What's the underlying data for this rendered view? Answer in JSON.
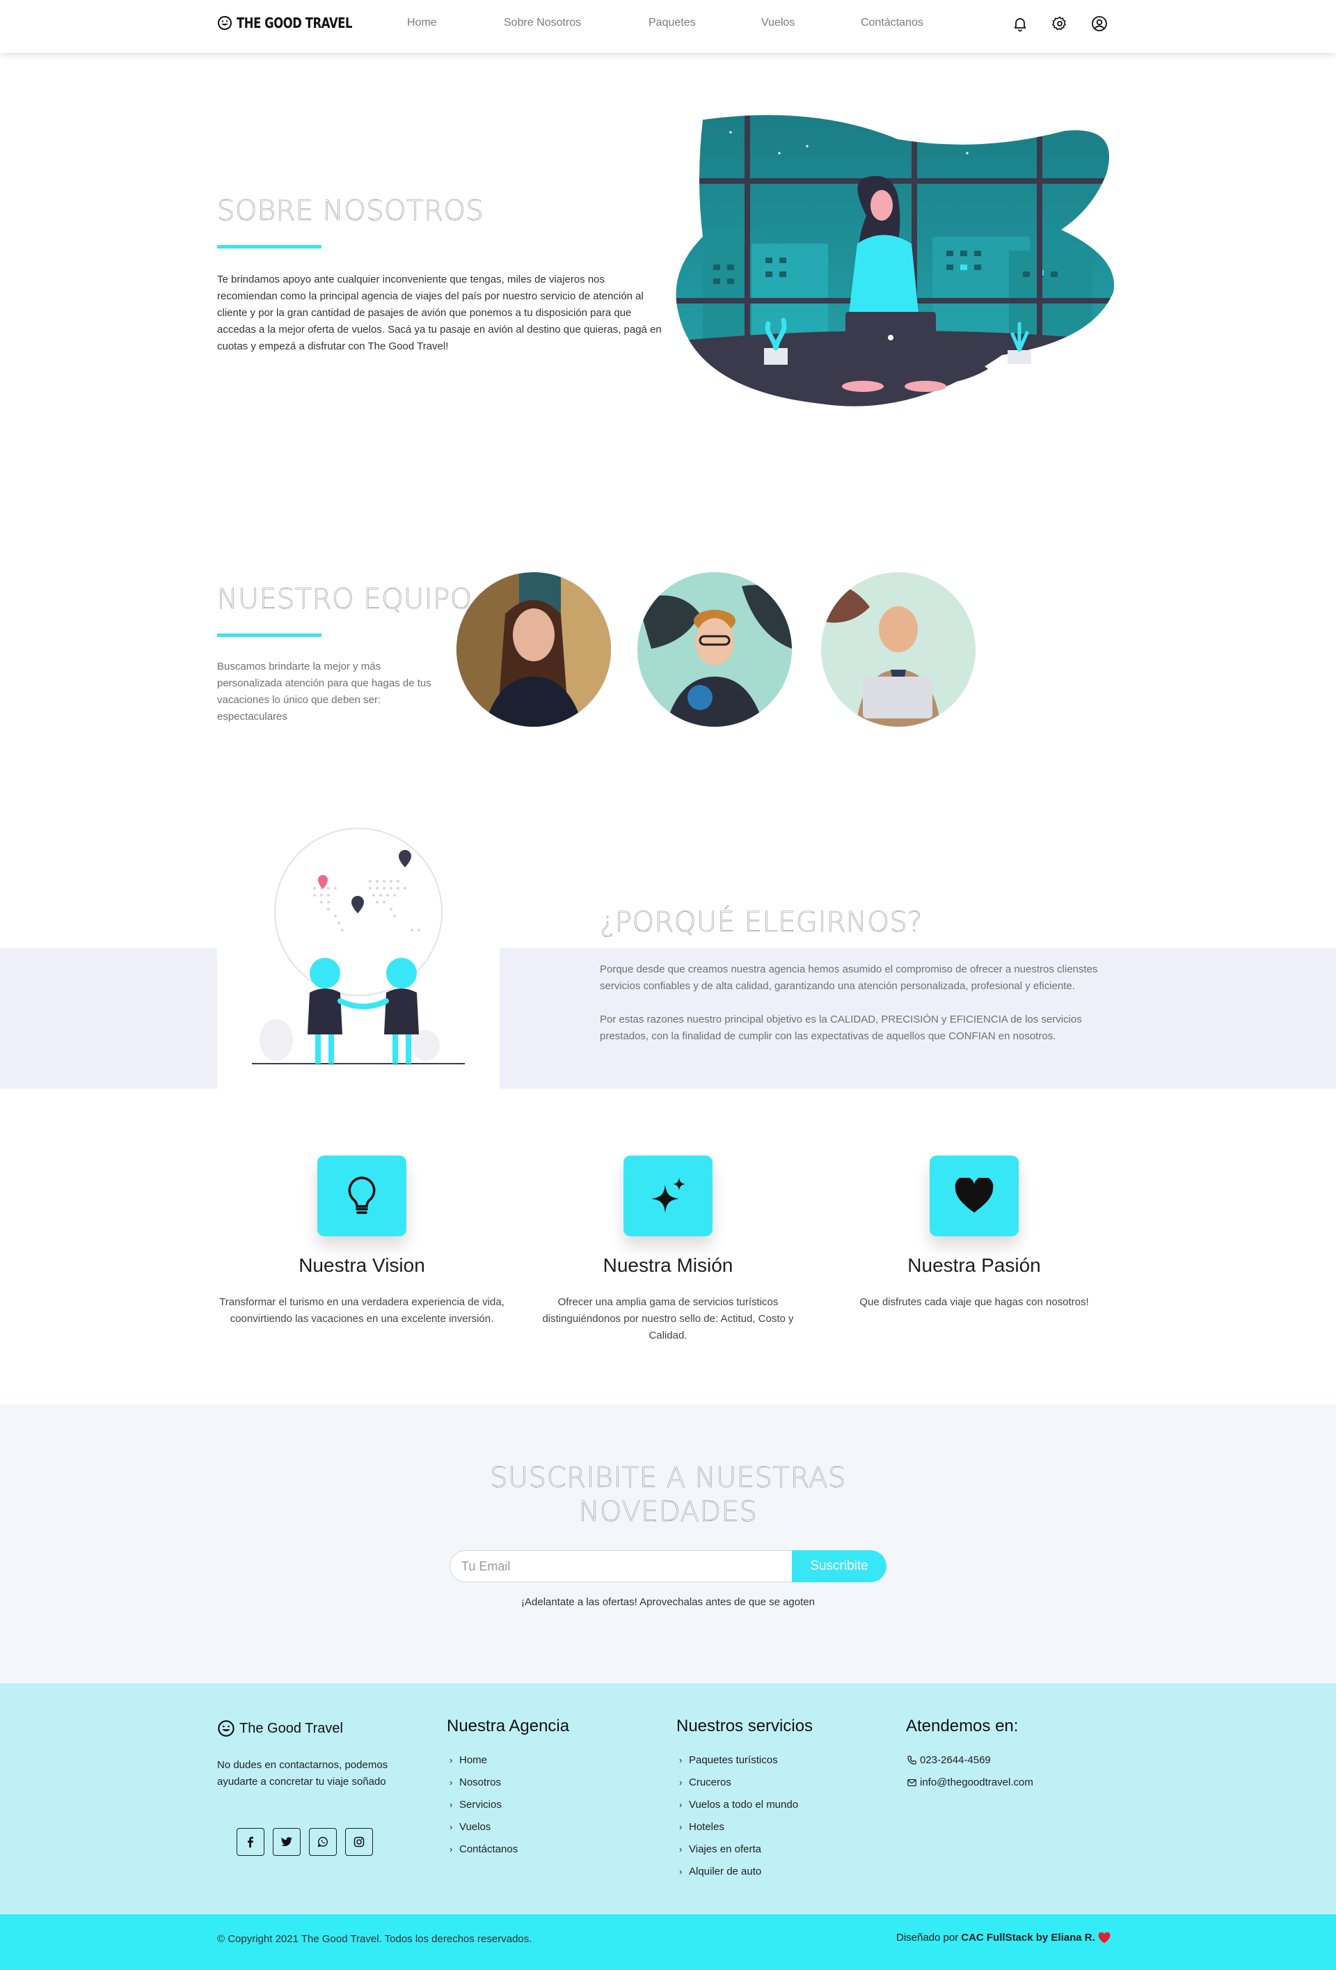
{
  "brand": {
    "name": "THE GOOD TRAVEL"
  },
  "nav": {
    "links": [
      "Home",
      "Sobre Nosotros",
      "Paquetes",
      "Vuelos",
      "Contáctanos"
    ],
    "icons": [
      "bell-icon",
      "gear-icon",
      "user-circle-icon"
    ]
  },
  "about": {
    "title": "SOBRE NOSOTROS",
    "text": "Te brindamos apoyo ante cualquier inconveniente que tengas, miles de viajeros nos recomiendan como la principal agencia de viajes del país por nuestro servicio de atención al cliente y por la gran cantidad de pasajes de avión que ponemos a tu disposición para que accedas a la mejor oferta de vuelos. Sacá ya tu pasaje en avión al destino que quieras, pagá en cuotas y empezá a disfrutar con The Good Travel!"
  },
  "team": {
    "title": "NUESTRO EQUIPO",
    "text": "Buscamos brindarte la mejor y más personalizada atención para que hagas de tus vacaciones lo único que deben ser: espectaculares"
  },
  "why": {
    "title": "¿PORQUÉ ELEGIRNOS?",
    "text1": "Porque desde que creamos nuestra agencia hemos asumido el compromiso de ofrecer a nuestros clienstes servicios confiables y de alta calidad, garantizando una atención personalizada, profesional y eficiente.",
    "text2": "Por estas razones nuestro principal objetivo es la CALIDAD, PRECISIÓN y EFICIENCIA de los servicios prestados, con la finalidad de cumplir con las expectativas de aquellos que CONFIAN en nosotros."
  },
  "cards": [
    {
      "icon": "lightbulb-icon",
      "title": "Nuestra Vision",
      "text": "Transformar el turismo en una verdadera experiencia de vida, coonvirtiendo las vacaciones en una excelente inversión."
    },
    {
      "icon": "sparkles-icon",
      "title": "Nuestra Misión",
      "text": "Ofrecer una amplia gama de servicios turísticos distinguiéndonos por nuestro sello de: Actitud, Costo y Calidad."
    },
    {
      "icon": "heart-icon",
      "title": "Nuestra Pasión",
      "text": "Que disfrutes cada viaje que hagas con nosotros!"
    }
  ],
  "subscribe": {
    "title_line1": "SUSCRIBITE A NUESTRAS",
    "title_line2": "NOVEDADES",
    "placeholder": "Tu Email",
    "button": "Suscribite",
    "note": "¡Adelantate a las ofertas! Aprovechalas antes de que se agoten"
  },
  "footer": {
    "brand": "The Good Travel",
    "tagline": "No dudes en contactarnos, podemos ayudarte a concretar tu viaje soñado",
    "social": [
      "facebook-icon",
      "twitter-icon",
      "whatsapp-icon",
      "instagram-icon"
    ],
    "agency": {
      "title": "Nuestra Agencia",
      "links": [
        "Home",
        "Nosotros",
        "Servicios",
        "Vuelos",
        "Contáctanos"
      ]
    },
    "services": {
      "title": "Nuestros servicios",
      "links": [
        "Paquetes turísticos",
        "Cruceros",
        "Vuelos a todo el mundo",
        "Hoteles",
        "Viajes en oferta",
        "Alquiler de auto"
      ]
    },
    "contact": {
      "title": "Atendemos en:",
      "phone": "023-2644-4569",
      "email": "info@thegoodtravel.com"
    },
    "copyright": "© Copyright 2021 The Good Travel. Todos los derechos reservados.",
    "credit_prefix": "Diseñado por",
    "credit_name": "CAC FullStack by Eliana R."
  },
  "colors": {
    "accent": "#38e7f5",
    "footer_bg": "#bff0f6",
    "band": "#efeffa",
    "teal_dark": "#1e7f85"
  }
}
